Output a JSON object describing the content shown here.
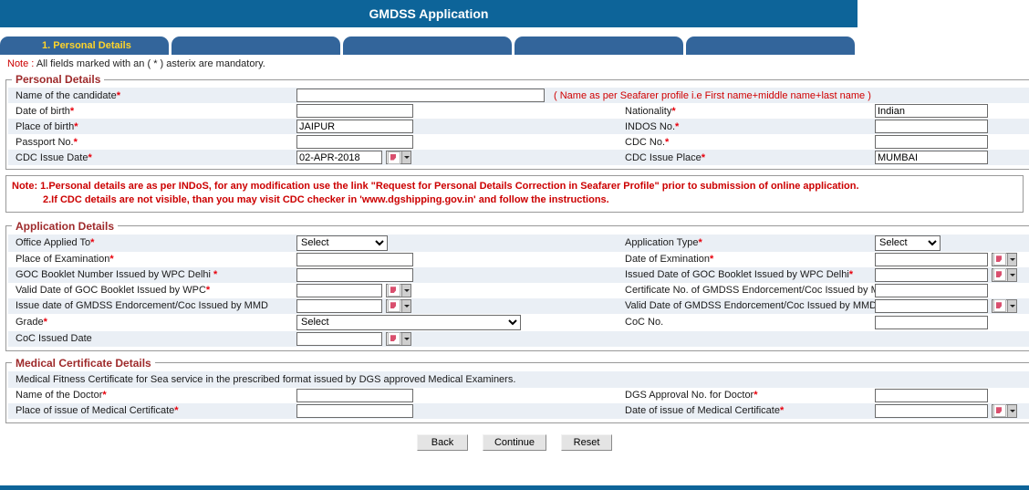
{
  "header": {
    "title": "GMDSS Application"
  },
  "tabs": [
    {
      "label": "1. Personal Details",
      "active": true
    },
    {
      "label": "",
      "active": false
    },
    {
      "label": "",
      "active": false
    },
    {
      "label": "",
      "active": false
    },
    {
      "label": "",
      "active": false
    }
  ],
  "note": {
    "label": "Note :",
    "text": "All fields marked with an ( * ) asterix are mandatory."
  },
  "personal_details": {
    "legend": "Personal Details",
    "name_label": "Name of the candidate",
    "name_value": "",
    "name_hint": "( Name as per Seafarer profile i.e First name+middle name+last name )",
    "dob_label": "Date of birth",
    "dob_value": "",
    "nationality_label": "Nationality",
    "nationality_value": "Indian",
    "pob_label": "Place of birth",
    "pob_value": "JAIPUR",
    "indos_label": "INDOS No.",
    "indos_value": "",
    "passport_label": "Passport No.",
    "passport_value": "",
    "cdc_no_label": "CDC No.",
    "cdc_no_value": "",
    "cdc_issue_date_label": "CDC Issue Date",
    "cdc_issue_date_value": "02-APR-2018",
    "cdc_issue_place_label": "CDC Issue Place",
    "cdc_issue_place_value": "MUMBAI"
  },
  "red_note": {
    "line1": "Note: 1.Personal details are as per INDoS, for any modification use the link \"Request for Personal Details Correction in Seafarer Profile\" prior to submission of online application.",
    "line2": "2.If CDC details are not visible, than you may visit CDC checker in 'www.dgshipping.gov.in' and follow the instructions."
  },
  "application_details": {
    "legend": "Application Details",
    "office_label": "Office Applied To",
    "office_value": "Select",
    "app_type_label": "Application Type",
    "app_type_value": "Select",
    "place_exam_label": "Place of Examination",
    "place_exam_value": "",
    "date_exam_label": "Date of Exmination",
    "date_exam_value": "",
    "goc_booklet_label": "GOC Booklet Number Issued by WPC Delhi ",
    "goc_booklet_value": "",
    "goc_issued_date_label": "Issued Date of GOC Booklet Issued by WPC Delhi",
    "goc_issued_date_value": "",
    "goc_valid_label": "Valid Date of GOC Booklet Issued by WPC",
    "goc_valid_value": "",
    "cert_no_label": "Certificate No. of GMDSS Endorcement/Coc Issued by MMD",
    "cert_no_value": "",
    "issue_gmdss_label": "Issue date of GMDSS Endorcement/Coc Issued by MMD",
    "issue_gmdss_value": "",
    "valid_gmdss_label": "Valid Date of GMDSS Endorcement/Coc Issued by MMD",
    "valid_gmdss_value": "",
    "grade_label": "Grade",
    "grade_value": "Select",
    "coc_no_label": "CoC No.",
    "coc_no_value": "",
    "coc_issued_date_label": "CoC Issued Date",
    "coc_issued_date_value": ""
  },
  "medical_details": {
    "legend": "Medical Certificate Details",
    "description": "Medical Fitness Certificate for Sea service in the prescribed format issued by DGS approved Medical Examiners.",
    "doctor_label": "Name of the Doctor",
    "doctor_value": "",
    "dgs_approval_label": "DGS Approval No. for Doctor",
    "dgs_approval_value": "",
    "place_issue_label": "Place of issue of Medical Certificate",
    "place_issue_value": "",
    "date_issue_label": "Date of issue of Medical Certificate",
    "date_issue_value": ""
  },
  "buttons": {
    "back": "Back",
    "continue": "Continue",
    "reset": "Reset"
  },
  "colors": {
    "header_blue": "#0d6499",
    "tab_blue": "#33659b",
    "tab_label_yellow": "#ffd42a",
    "legend_red": "#9e2a2b",
    "note_red": "#cc0000",
    "row_alt": "#eaeff5"
  },
  "icons": {
    "date_picker": "calendar-picker-icon",
    "dropdown": "chevron-down-icon"
  }
}
